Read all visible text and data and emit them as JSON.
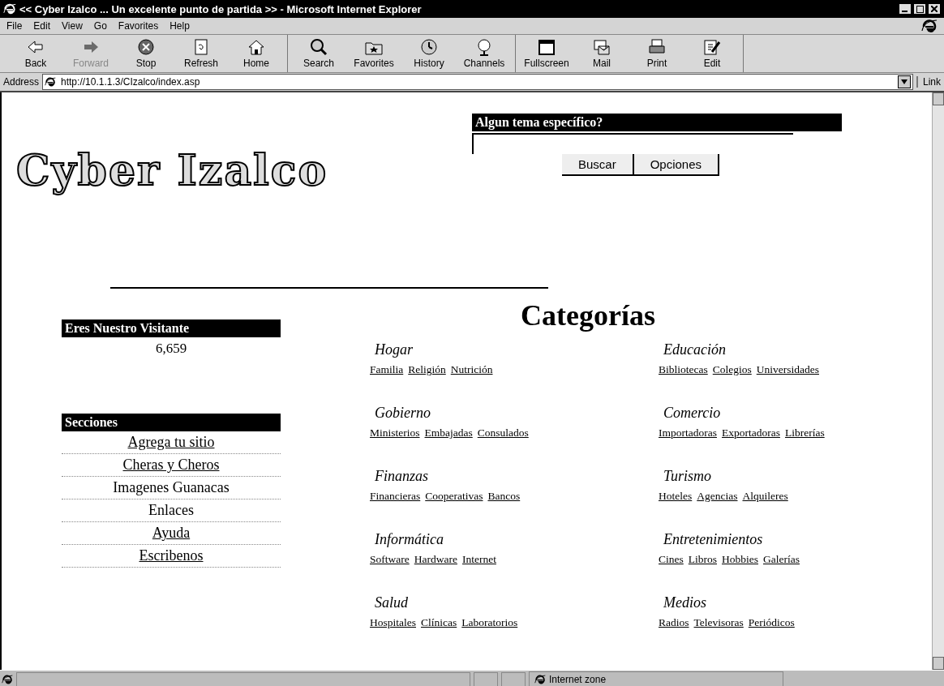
{
  "window": {
    "title": "<< Cyber Izalco ... Un excelente punto de partida  >> - Microsoft Internet Explorer"
  },
  "menu": [
    "File",
    "Edit",
    "View",
    "Go",
    "Favorites",
    "Help"
  ],
  "toolbar": [
    {
      "label": "Back",
      "disabled": false
    },
    {
      "label": "Forward",
      "disabled": true
    },
    {
      "label": "Stop",
      "disabled": false
    },
    {
      "label": "Refresh",
      "disabled": false
    },
    {
      "label": "Home",
      "disabled": false
    },
    {
      "label": "Search",
      "disabled": false
    },
    {
      "label": "Favorites",
      "disabled": false
    },
    {
      "label": "History",
      "disabled": false
    },
    {
      "label": "Channels",
      "disabled": false
    },
    {
      "label": "Fullscreen",
      "disabled": false
    },
    {
      "label": "Mail",
      "disabled": false
    },
    {
      "label": "Print",
      "disabled": false
    },
    {
      "label": "Edit",
      "disabled": false
    }
  ],
  "address_bar": {
    "label": "Address",
    "value": "http://10.1.1.3/CIzalco/index.asp",
    "links": "Link"
  },
  "page": {
    "logo": "Cyber Izalco",
    "search": {
      "heading": "Algun tema específico?",
      "buttons": [
        "Buscar",
        "Opciones"
      ]
    },
    "visitors": {
      "heading": "Eres Nuestro Visitante",
      "count": "6,659"
    },
    "sections": {
      "heading": "Secciones",
      "items": [
        {
          "label": "Agrega tu sitio",
          "link": true
        },
        {
          "label": "Cheras y Cheros",
          "link": true
        },
        {
          "label": "Imagenes Guanacas",
          "link": false
        },
        {
          "label": "Enlaces",
          "link": false
        },
        {
          "label": "Ayuda",
          "link": true
        },
        {
          "label": "Escribenos",
          "link": true
        }
      ]
    },
    "categories": {
      "title": "Categorías",
      "groups": [
        {
          "name": "Hogar",
          "links": [
            "Familia",
            "Religión",
            "Nutrición"
          ]
        },
        {
          "name": "Educación",
          "links": [
            "Bibliotecas",
            "Colegios",
            "Universidades"
          ]
        },
        {
          "name": "Gobierno",
          "links": [
            "Ministerios",
            "Embajadas",
            "Consulados"
          ]
        },
        {
          "name": "Comercio",
          "links": [
            "Importadoras",
            "Exportadoras",
            "Librerías"
          ]
        },
        {
          "name": "Finanzas",
          "links": [
            "Financieras",
            "Cooperativas",
            "Bancos"
          ]
        },
        {
          "name": "Turismo",
          "links": [
            "Hoteles",
            "Agencias",
            "Alquileres"
          ]
        },
        {
          "name": "Informática",
          "links": [
            "Software",
            "Hardware",
            "Internet"
          ]
        },
        {
          "name": "Entretenimientos",
          "links": [
            "Cines",
            "Libros",
            "Hobbies",
            "Galerías"
          ]
        },
        {
          "name": "Salud",
          "links": [
            "Hospitales",
            "Clínicas",
            "Laboratorios"
          ]
        },
        {
          "name": "Medios",
          "links": [
            "Radios",
            "Televisoras",
            "Periódicos"
          ]
        }
      ]
    }
  },
  "status_bar": {
    "zone": "Internet zone"
  }
}
